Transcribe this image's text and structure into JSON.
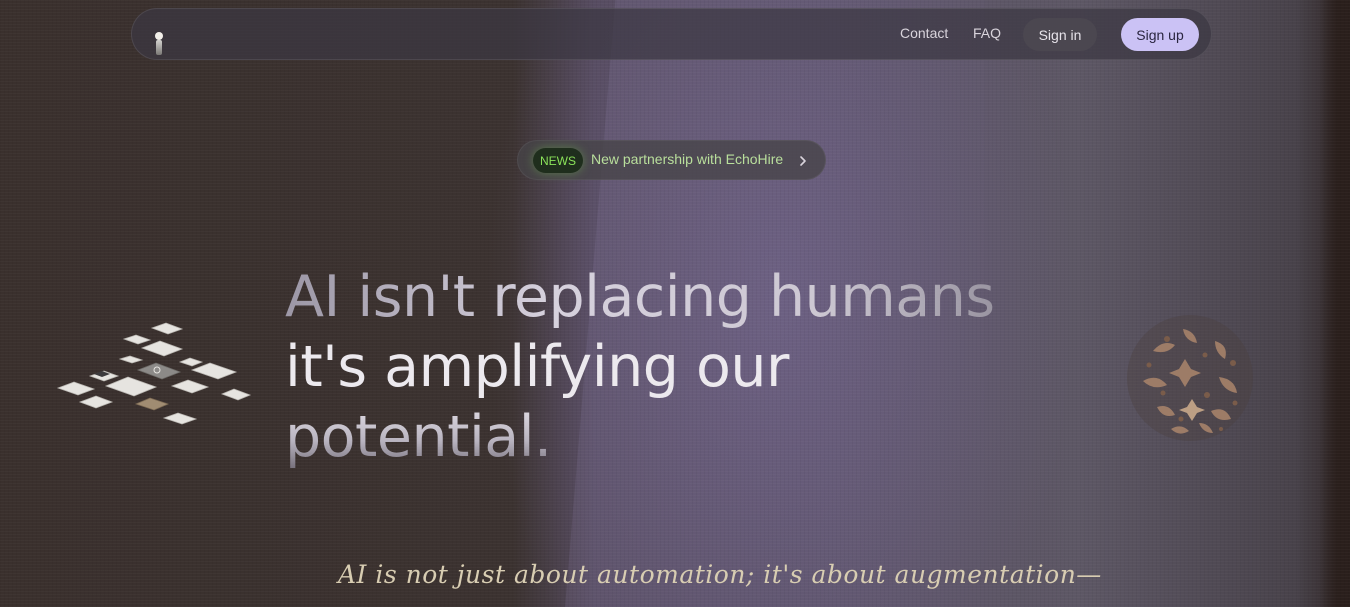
{
  "nav": {
    "logo_icon": "figure-icon",
    "links": [
      {
        "label": "Contact"
      },
      {
        "label": "FAQ"
      }
    ],
    "signin_label": "Sign in",
    "signup_label": "Sign up"
  },
  "news": {
    "badge": "NEWS",
    "text": "New partnership with EchoHire",
    "icon": "chevron-right-icon"
  },
  "hero": {
    "line1": "AI isn't replacing humans",
    "line2": "it's amplifying our",
    "line3": "potential."
  },
  "tagline": "AI is not just about automation; it's about augmentation—",
  "colors": {
    "accent": "#cbc2f5",
    "news_green": "#8be35a",
    "tagline": "#d8cdb2"
  },
  "decorations": {
    "left": "cube-cluster-illustration",
    "right": "botanical-circle-illustration"
  }
}
